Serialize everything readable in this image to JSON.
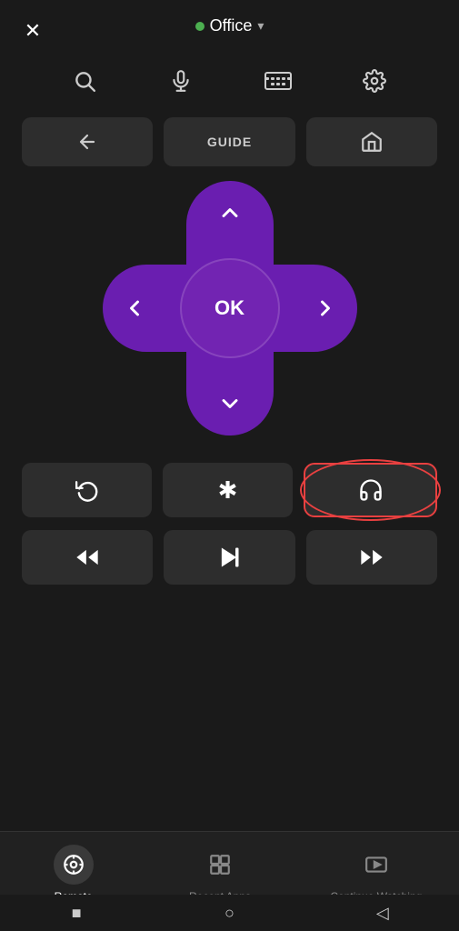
{
  "header": {
    "close_label": "✕",
    "device_name": "Office",
    "dropdown_indicator": "▾"
  },
  "toolbar": {
    "search_label": "🔍",
    "mic_label": "🎤",
    "keyboard_label": "⌨",
    "settings_label": "⚙"
  },
  "controls": {
    "back_label": "←",
    "guide_label": "GUIDE",
    "home_label": "⌂"
  },
  "dpad": {
    "up_label": "∧",
    "down_label": "∨",
    "left_label": "<",
    "right_label": ">",
    "ok_label": "OK"
  },
  "media_buttons": {
    "replay_label": "↺",
    "star_label": "✱",
    "headphone_label": "🎧",
    "rewind_label": "«",
    "playpause_label": "▶⏸",
    "fastforward_label": "»"
  },
  "bottom_nav": {
    "items": [
      {
        "id": "remote",
        "label": "Remote",
        "icon": "remote-icon",
        "active": true
      },
      {
        "id": "recent-apps",
        "label": "Recent Apps",
        "icon": "recent-apps-icon",
        "active": false
      },
      {
        "id": "continue-watching",
        "label": "Continue Watching",
        "icon": "continue-watching-icon",
        "active": false
      }
    ]
  },
  "sys_nav": {
    "square_label": "■",
    "circle_label": "○",
    "back_label": "◁"
  },
  "colors": {
    "background": "#1a1a1a",
    "purple_dpad": "#7b2fbe",
    "active_nav": "#ffffff",
    "inactive_nav": "#888888",
    "green_dot": "#4caf50",
    "headphone_ring": "#e84040"
  }
}
